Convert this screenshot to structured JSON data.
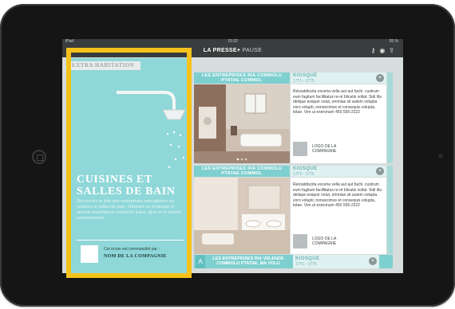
{
  "status_bar": {
    "device": "iPad",
    "time": "15:32",
    "battery": "55 %"
  },
  "app_bar": {
    "brand": "LA PRESSE+",
    "brand_sub": "PAUSE"
  },
  "left_panel": {
    "section": "EXTRA HABITATION",
    "title": "CUISINES ET SALLES DE BAIN",
    "body": "Découvrez la liste des entreprises spécialisées en cuisines et salles de bain. Obtenez un éclairage et aucune importance consectur Eque. Ignis et in venerit consequebani.",
    "sponsor_line": "Cet écran est commandité par :",
    "sponsor_name": "NOM DE LA COMPAGNIE"
  },
  "listings": [
    {
      "header": "LES ENTREPRISES RIA COMMOLU PTATAE COMMOL",
      "kiosk_title": "KIOSQUE",
      "kiosk_number": "1771 - 1775",
      "description": "Reiciatdiscita exceria vella aut aut fachi. custrum eum fugitum facillitatus re-nt blicatis vollat. Sidi illa delique esiquor volut, ommias sit autem volupta voro volupti, nonsecimos et consequis volupta, totae. Ven ut exeronum 450 555-2222",
      "logo_caption": "LOGO DE LA COMPAGNIE"
    },
    {
      "header": "LES ENTREPRISES RIA COMMOLU PTATAE COMMOL",
      "kiosk_title": "KIOSQUE",
      "kiosk_number": "1772 - 1775",
      "description": "Reiciatdiscita exceria vella aut aut fachi. custrum eum fugitum facillitatus re-nt blicatis vollat. Sidi illa delique esiquor volut, ommias sit autem volupta voro volupti, nonsecimos et consequis volupta, totae. Ven ut exeronum 450 555-2222",
      "logo_caption": "LOGO DE LA COMPAGNIE"
    }
  ],
  "bottom_strip": {
    "letter": "A",
    "header": "LES ENTREPRISES RIA VELENDE COMMOLU PTATAE, MA VOLU",
    "kiosk_title": "KIOSQUE",
    "kiosk_number": "1771 - 1775"
  },
  "colors": {
    "accent": "#7ecfcf",
    "panel": "#8fd7d8",
    "highlight": "#f5c21b"
  },
  "icons": {
    "plus": "plus-circle-icon",
    "key": "key-icon",
    "account": "account-icon",
    "share": "share-icon"
  }
}
